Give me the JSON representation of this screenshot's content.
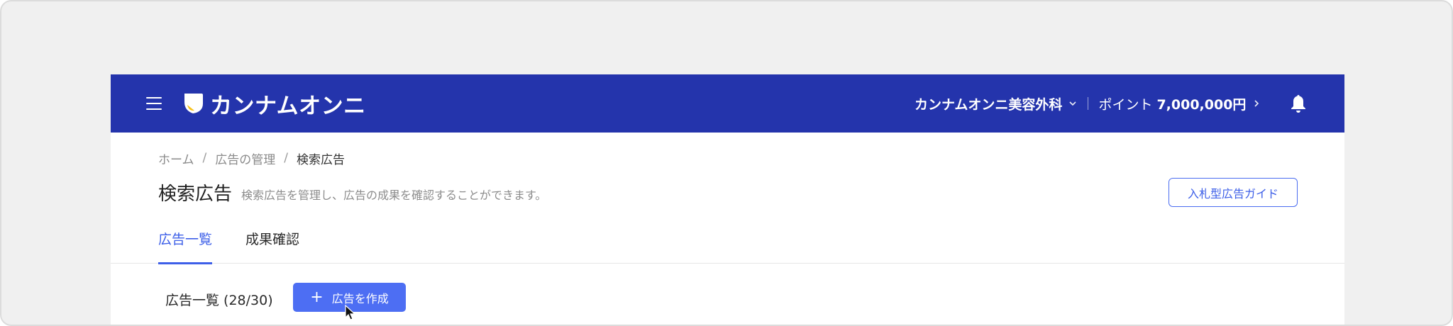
{
  "header": {
    "brand": "カンナムオンニ",
    "account_name": "カンナムオンニ美容外科",
    "points_label": "ポイント",
    "points_value": "7,000,000円"
  },
  "icons": {
    "menu": "hamburger-icon",
    "logo": "logo-mark",
    "account_chevron": "chevron-down-icon",
    "points_chevron": "chevron-right-icon",
    "notifications": "bell-icon",
    "add": "plus-icon",
    "cursor": "mouse-pointer"
  },
  "breadcrumb": {
    "items": [
      "ホーム",
      "広告の管理",
      "検索広告"
    ],
    "separator": "/"
  },
  "page": {
    "title": "検索広告",
    "description": "検索広告を管理し、広告の成果を確認することができます。",
    "guide_button": "入札型広告ガイド"
  },
  "tabs": [
    {
      "label": "広告一覧",
      "active": true
    },
    {
      "label": "成果確認",
      "active": false
    }
  ],
  "ad_list": {
    "title": "広告一覧 (28/30)",
    "create_button": "広告を作成"
  },
  "colors": {
    "header_bg": "#2434ac",
    "accent": "#4d6ef3",
    "page_bg": "#f0f0f0"
  }
}
